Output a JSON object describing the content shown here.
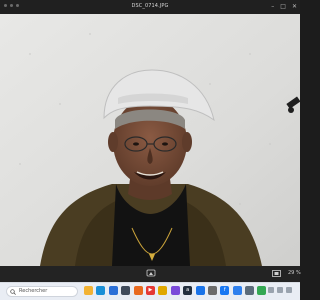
{
  "window": {
    "title": "DSC_0714.JPG"
  },
  "viewer": {
    "image_label": "photo"
  },
  "toolbar": {
    "zoom": "29 %",
    "left_label": ""
  },
  "taskbar": {
    "search_placeholder": "Rechercher",
    "apps": [
      {
        "name": "file-explorer-icon",
        "color": "#f2b233",
        "glyph": ""
      },
      {
        "name": "edge-icon",
        "color": "#1a8fd6",
        "glyph": ""
      },
      {
        "name": "store-icon",
        "color": "#2b6fd6",
        "glyph": ""
      },
      {
        "name": "calendar-icon",
        "color": "#3f4a5a",
        "glyph": ""
      },
      {
        "name": "firefox-icon",
        "color": "#e86a20",
        "glyph": ""
      },
      {
        "name": "youtube-icon",
        "color": "#e53935",
        "glyph": "▶"
      },
      {
        "name": "folder-icon",
        "color": "#e0a800",
        "glyph": ""
      },
      {
        "name": "photos-icon",
        "color": "#7a4ad9",
        "glyph": ""
      },
      {
        "name": "amazon-icon",
        "color": "#232f3e",
        "glyph": "a"
      },
      {
        "name": "dropbox-icon",
        "color": "#1a73e8",
        "glyph": ""
      },
      {
        "name": "settings-icon",
        "color": "#6b6b6b",
        "glyph": ""
      },
      {
        "name": "facebook-icon",
        "color": "#1877f2",
        "glyph": "f"
      },
      {
        "name": "browser-icon",
        "color": "#2f80ed",
        "glyph": ""
      },
      {
        "name": "app-icon",
        "color": "#5b6b7a",
        "glyph": ""
      },
      {
        "name": "chrome-icon",
        "color": "#34a853",
        "glyph": ""
      }
    ]
  }
}
